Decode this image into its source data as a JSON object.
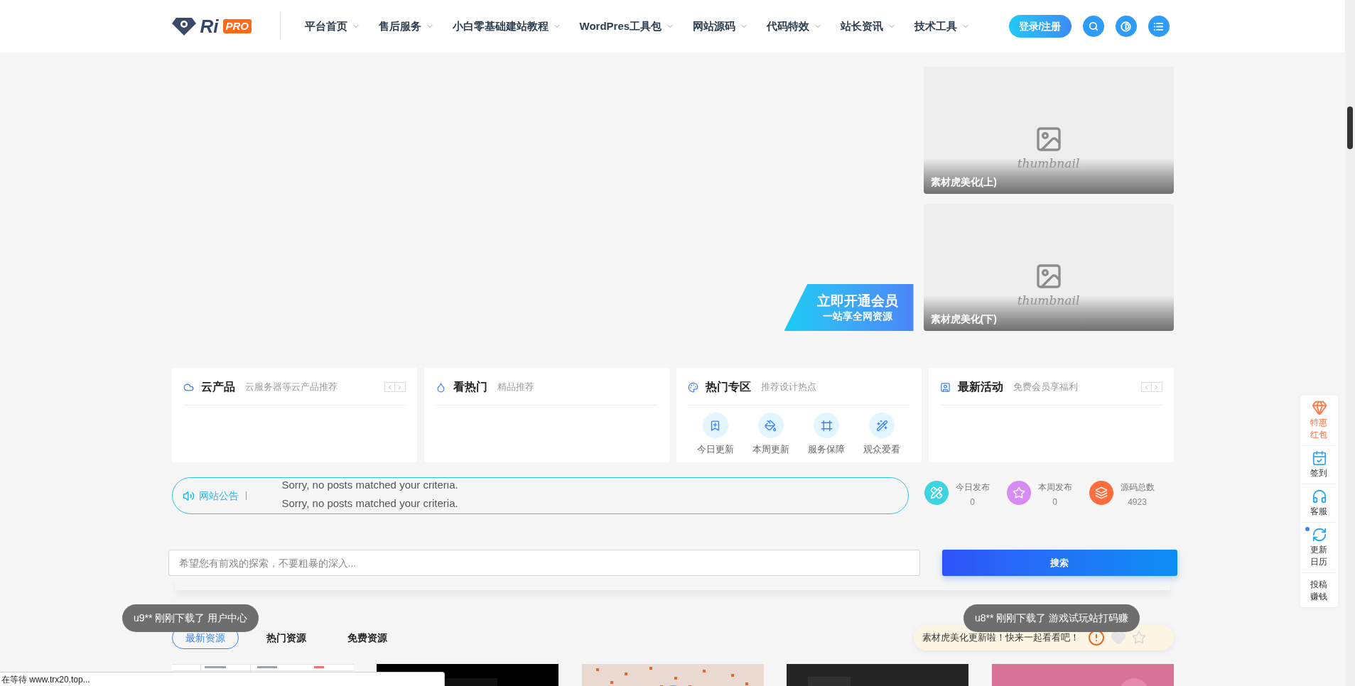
{
  "header": {
    "logo": {
      "text": "Ri",
      "badge": "PRO"
    },
    "nav": [
      {
        "label": "平台首页"
      },
      {
        "label": "售后服务"
      },
      {
        "label": "小白零基础建站教程"
      },
      {
        "label": "WordPres工具包"
      },
      {
        "label": "网站源码"
      },
      {
        "label": "代码特效"
      },
      {
        "label": "站长资讯"
      },
      {
        "label": "技术工具"
      }
    ],
    "login": "登录/注册"
  },
  "banner": {
    "vip": {
      "title": "立即开通会员",
      "subtitle": "一站享全网资源"
    },
    "thumbs": [
      {
        "placeholder": "thumbnail",
        "title": "素材虎美化(上)"
      },
      {
        "placeholder": "thumbnail",
        "title": "素材虎美化(下)"
      }
    ]
  },
  "cards": [
    {
      "kind": "cloud",
      "title": "云产品",
      "subtitle": "云服务器等云产品推荐",
      "pager": true
    },
    {
      "kind": "hot",
      "title": "看热门",
      "subtitle": "精品推荐",
      "pager": false
    },
    {
      "kind": "palette",
      "title": "热门专区",
      "subtitle": "推荐设计热点",
      "pager": false,
      "links": [
        {
          "kind": "bookmark",
          "label": "今日更新"
        },
        {
          "kind": "bucket",
          "label": "本周更新"
        },
        {
          "kind": "frame",
          "label": "服务保障"
        },
        {
          "kind": "wand",
          "label": "观众爱看"
        }
      ]
    },
    {
      "kind": "contact",
      "title": "最新活动",
      "subtitle": "免费会员享福利",
      "pager": true
    }
  ],
  "notice": {
    "label": "网站公告",
    "lines": [
      "Sorry, no posts matched your criteria.",
      "Sorry, no posts matched your criteria."
    ]
  },
  "stats": [
    {
      "kind": "ruler",
      "label": "今日发布",
      "value": "0",
      "color": "#3dd3e0"
    },
    {
      "kind": "star",
      "label": "本周发布",
      "value": "0",
      "color": "#d68cf3"
    },
    {
      "kind": "layers",
      "label": "源码总数",
      "value": "4923",
      "color": "#ff6d3f"
    }
  ],
  "search": {
    "placeholder": "希望您有前戏的探索，不要粗暴的深入...",
    "button": "搜索"
  },
  "tabs": [
    {
      "label": "最新资源",
      "selected": true
    },
    {
      "label": "热门资源",
      "selected": false
    },
    {
      "label": "免费资源",
      "selected": false
    }
  ],
  "alert": {
    "text": "素材虎美化更新啦！快来一起看看吧！"
  },
  "toasts": [
    "u9** 刚刚下载了 用户中心",
    "u8** 刚刚下载了 游戏试玩站打码赚"
  ],
  "posts": [
    {
      "kind": "table"
    },
    {
      "kind": "black"
    },
    {
      "kind": "dots"
    },
    {
      "kind": "dark"
    },
    {
      "kind": "pink"
    }
  ],
  "float_bar": [
    {
      "kind": "gem",
      "label": "特惠红包"
    },
    {
      "kind": "calendar",
      "label": "签到"
    },
    {
      "kind": "headset",
      "label": "客服"
    },
    {
      "kind": "refresh",
      "label": "更新日历"
    },
    {
      "kind": "text",
      "label": "投稿赚钱"
    }
  ],
  "status_bar": "在等待 www.trx20.top..."
}
